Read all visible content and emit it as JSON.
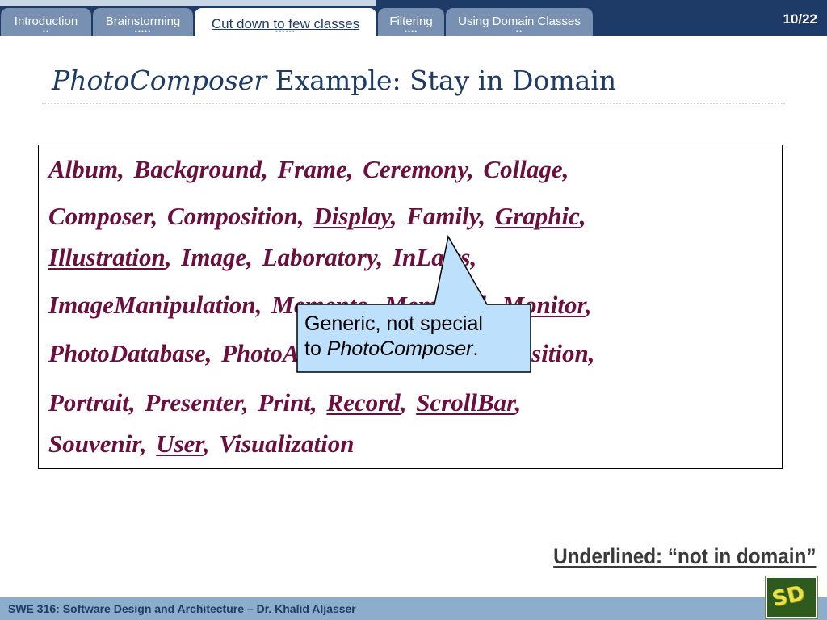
{
  "nav": {
    "tabs": [
      {
        "label": "Introduction",
        "dots": "••"
      },
      {
        "label": "Brainstorming",
        "dots": "•••••"
      },
      {
        "label": "Cut down to few classes",
        "dots": "••••••",
        "active": true
      },
      {
        "label": "Filtering",
        "dots": "••••"
      },
      {
        "label": "Using Domain Classes",
        "dots": "••"
      }
    ],
    "page_number": "10/22"
  },
  "slide": {
    "title_italic": "PhotoComposer",
    "title_rest": " Example: Stay in Domain",
    "class_lines": [
      [
        {
          "t": "Album,  Background,  Frame,  Ceremony,  Collage,"
        }
      ],
      [
        {
          "t": "Composer,  Composition,  "
        },
        {
          "t": "Display",
          "u": true
        },
        {
          "t": ",  Family,  "
        },
        {
          "t": "Graphic",
          "u": true
        },
        {
          "t": ","
        }
      ],
      [
        {
          "t": "Illustration",
          "u": true
        },
        {
          "t": ",  Image,  Laboratory,  InLaws,"
        }
      ],
      [
        {
          "t": "ImageManipulation,  Memento,  Memorial,  "
        },
        {
          "t": "Monitor",
          "u": true
        },
        {
          "t": ","
        }
      ],
      [
        {
          "t": "PhotoDatabase,  PhotoAlbum,  FamilyTree,  Position,"
        }
      ],
      [
        {
          "t": "Portrait,  Presenter,  Print,  "
        },
        {
          "t": "Record",
          "u": true
        },
        {
          "t": ",  "
        },
        {
          "t": "ScrollBar",
          "u": true
        },
        {
          "t": ","
        }
      ],
      [
        {
          "t": "Souvenir,  "
        },
        {
          "t": "User",
          "u": true
        },
        {
          "t": ",  Visualization"
        }
      ]
    ],
    "callout": {
      "line1": "Generic, not special",
      "line2_prefix": "to ",
      "line2_italic": "PhotoComposer",
      "line2_suffix": "."
    },
    "note": "Underlined: “not in domain”"
  },
  "footer": {
    "text": "SWE 316: Software Design and Architecture – Dr. Khalid Aljasser",
    "logo_glyph": "SD"
  },
  "colors": {
    "nav_bg": "#1d3b66",
    "tab_bg": "#7891b3",
    "class_text": "#6b0f3e",
    "callout_fill": "#bde0fc",
    "footer_bg": "#8eaccc"
  }
}
